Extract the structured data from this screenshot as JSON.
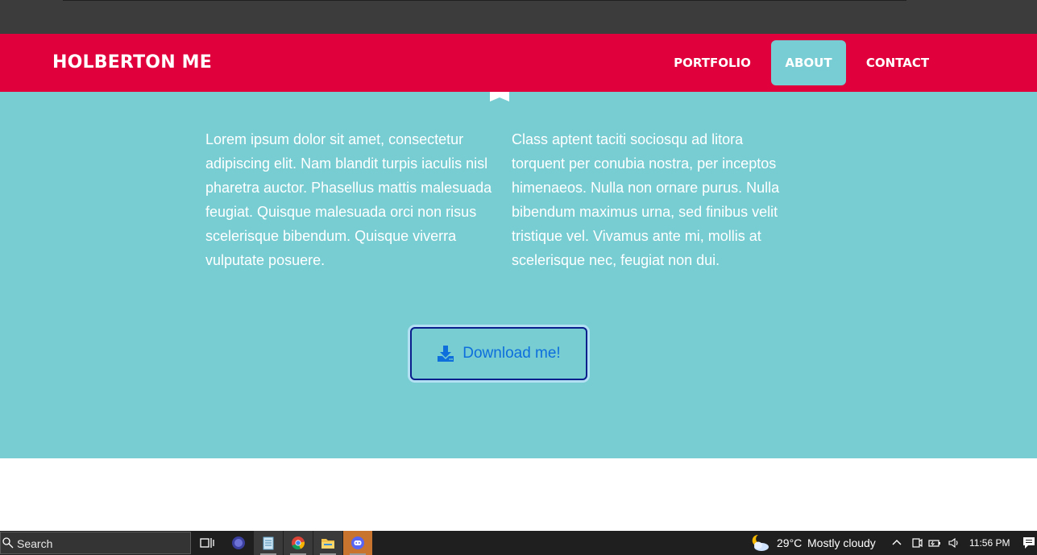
{
  "navbar": {
    "brand": "HOLBERTON ME",
    "items": [
      {
        "label": "PORTFOLIO",
        "active": false
      },
      {
        "label": "ABOUT",
        "active": true
      },
      {
        "label": "CONTACT",
        "active": false
      }
    ]
  },
  "about": {
    "column_left": "Lorem ipsum dolor sit amet, consectetur adipiscing elit. Nam blandit turpis iaculis nisl pharetra auctor. Phasellus mattis malesuada feugiat. Quisque malesuada orci non risus scelerisque bibendum. Quisque viverra vulputate posuere.",
    "column_right": "Class aptent taciti sociosqu ad litora torquent per conubia nostra, per inceptos himenaeos. Nulla non ornare purus. Nulla bibendum maximus urna, sed finibus velit tristique vel. Vivamus ante mi, mollis at scelerisque nec, feugiat non dui.",
    "download_label": "Download me!"
  },
  "taskbar": {
    "search_placeholder": "Search",
    "apps": [
      "task-view",
      "mb-app",
      "notepad",
      "chrome",
      "file-explorer",
      "discord"
    ],
    "weather_temp": "29°C",
    "weather_desc": "Mostly cloudy",
    "time": "11:56 PM"
  },
  "colors": {
    "navbar_bg": "#e0003c",
    "about_bg": "#78cdd3",
    "active_nav_bg": "#77cdd3",
    "button_border": "#0a1e8c",
    "button_text": "#0d6edc",
    "browser_strip": "#3c3c3c",
    "taskbar_bg": "#1f1f1f"
  }
}
